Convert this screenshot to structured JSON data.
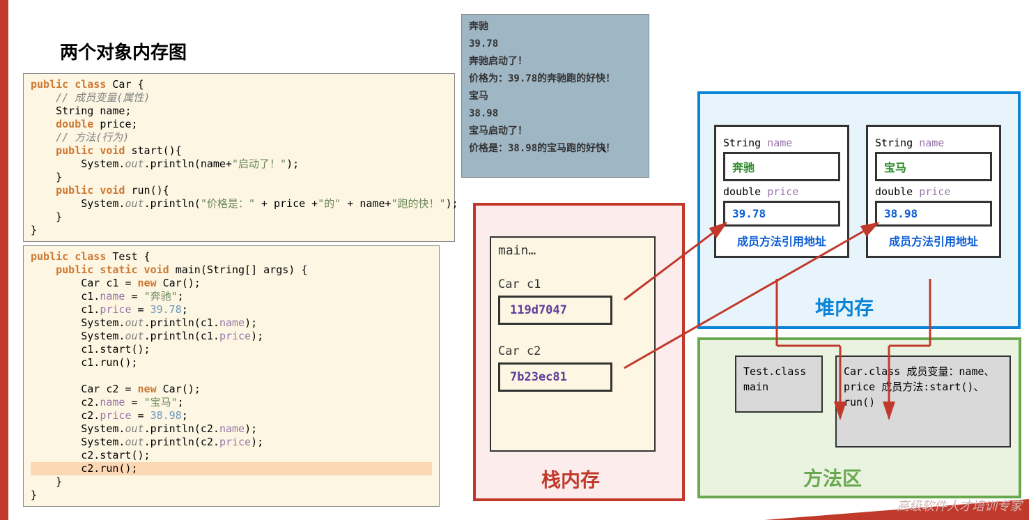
{
  "title": "两个对象内存图",
  "code1": "public class Car {\n    // 成员变量(属性)\n    String name;\n    double price;\n    // 方法(行为)\n    public void start(){\n        System.out.println(name+\"启动了！\");\n    }\n    public void run(){\n        System.out.println(\"价格是：\" + price +\"的\" + name+\"跑的快！\");\n    }\n}",
  "code2": "public class Test {\n    public static void main(String[] args) {\n        Car c1 = new Car();\n        c1.name = \"奔驰\";\n        c1.price = 39.78;\n        System.out.println(c1.name);\n        System.out.println(c1.price);\n        c1.start();\n        c1.run();\n\n        Car c2 = new Car();\n        c2.name = \"宝马\";\n        c2.price = 38.98;\n        System.out.println(c2.name);\n        System.out.println(c2.price);\n        c2.start();\n        c2.run();\n    }\n}",
  "console": {
    "lines": [
      "奔驰",
      "39.78",
      "奔驰启动了！",
      "价格为：39.78的奔驰跑的好快！",
      "宝马",
      "38.98",
      "宝马启动了！",
      "价格是：38.98的宝马跑的好快！"
    ]
  },
  "stack": {
    "label": "栈内存",
    "frame_title": "main…",
    "vars": [
      {
        "label": "Car c1",
        "addr": "119d7047"
      },
      {
        "label": "Car c2",
        "addr": "7b23ec81"
      }
    ]
  },
  "heap": {
    "label": "堆内存",
    "objects": [
      {
        "name_label": "String name",
        "name_value": "奔驰",
        "price_label": "double price",
        "price_value": "39.78",
        "method_ref": "成员方法引用地址"
      },
      {
        "name_label": "String name",
        "name_value": "宝马",
        "price_label": "double price",
        "price_value": "38.98",
        "method_ref": "成员方法引用地址"
      }
    ]
  },
  "method_area": {
    "label": "方法区",
    "test": [
      "Test.class",
      "",
      "main"
    ],
    "car": [
      "Car.class",
      "",
      "成员变量：name、price",
      "",
      "成员方法:start()、run()"
    ]
  },
  "footer": "高级软件人才培训专家"
}
